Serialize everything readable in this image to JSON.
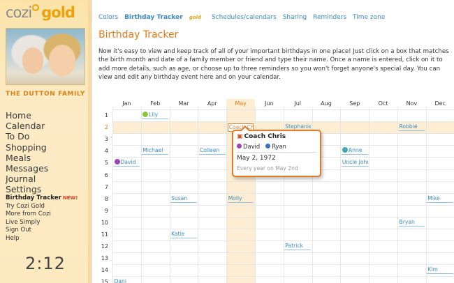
{
  "app": {
    "logo_cozi": "cozi",
    "logo_gold": "gold",
    "family_name": "THE DUTTON FAMILY",
    "photo": "family-photo",
    "clock": "2:12"
  },
  "nav_main": [
    "Home",
    "Calendar",
    "To Do",
    "Shopping",
    "Meals",
    "Messages",
    "Journal",
    "Settings"
  ],
  "nav_sub": {
    "active_label": "Birthday Tracker",
    "new_badge": "NEW!",
    "items": [
      "Try Cozi Gold",
      "More from Cozi",
      "Live Simply",
      "Sign Out",
      "Help"
    ]
  },
  "tabs": {
    "colors": "Colors",
    "birthday": "Birthday Tracker",
    "birthday_gold": "gold",
    "schedules": "Schedules/calendars",
    "sharing": "Sharing",
    "reminders": "Reminders",
    "timezone": "Time zone"
  },
  "page": {
    "title": "Birthday Tracker",
    "intro": "Now it's easy to view and keep track of all of your important birthdays in one place! Just click on a box that matches the birth month and date of a family member or friend and type their name. Once a name is entered, click on it to add more details, such as age, or choose up to three reminders so you won't forget anyone's special day. You can view and edit any birthday event here and on your calendar."
  },
  "grid": {
    "months": [
      "Jan",
      "Feb",
      "Mar",
      "Apr",
      "May",
      "Jun",
      "Jul",
      "Aug",
      "Sep",
      "Oct",
      "Nov",
      "Dec"
    ],
    "days": [
      "1",
      "2",
      "3",
      "4",
      "5",
      "6",
      "7",
      "8",
      "9",
      "10",
      "11",
      "12",
      "13",
      "14",
      "15"
    ],
    "highlight_month": 4,
    "highlight_day": 1,
    "entries": [
      {
        "name": "Lily",
        "month": 1,
        "day": 0,
        "dot": "#8cc63e"
      },
      {
        "name": "Coach Chr",
        "month": 4,
        "day": 1,
        "editing": true
      },
      {
        "name": "Stephanie",
        "month": 6,
        "day": 1
      },
      {
        "name": "Robbie",
        "month": 10,
        "day": 1
      },
      {
        "name": "Michael",
        "month": 1,
        "day": 3
      },
      {
        "name": "Colleen",
        "month": 3,
        "day": 3
      },
      {
        "name": "Anne",
        "month": 8,
        "day": 3,
        "dot": "#3fa8b7"
      },
      {
        "name": "David",
        "month": 0,
        "day": 4,
        "dot": "#9b46b5"
      },
      {
        "name": "Uncle John",
        "month": 8,
        "day": 4
      },
      {
        "name": "Susan",
        "month": 2,
        "day": 7
      },
      {
        "name": "Molly",
        "month": 4,
        "day": 7
      },
      {
        "name": "Mike",
        "month": 11,
        "day": 7
      },
      {
        "name": "Bryan",
        "month": 10,
        "day": 9
      },
      {
        "name": "Katie",
        "month": 2,
        "day": 10
      },
      {
        "name": "Patrick",
        "month": 6,
        "day": 11
      },
      {
        "name": "Kim",
        "month": 11,
        "day": 13
      },
      {
        "name": "Dani",
        "month": 0,
        "day": 14
      }
    ]
  },
  "popup": {
    "title": "Coach Chris",
    "person1": "David",
    "person1_color": "#9b46b5",
    "person2": "Ryan",
    "person2_color": "#3a6fc4",
    "date": "May 2, 1972",
    "recurrence": "Every year on May 2nd"
  }
}
